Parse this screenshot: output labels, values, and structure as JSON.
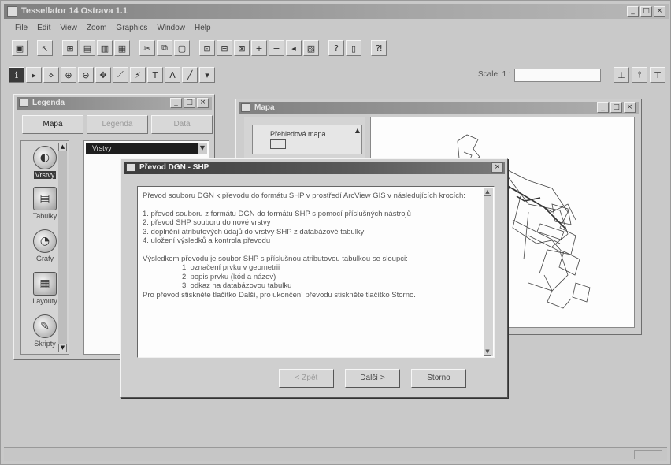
{
  "app": {
    "title": "Tessellator  14 Ostrava  1.1",
    "menu": [
      "File",
      "Edit",
      "View",
      "Zoom",
      "Graphics",
      "Window",
      "Help"
    ],
    "scale_label": "Scale: 1 :",
    "scale_value": ""
  },
  "left_panel": {
    "title": "Legenda",
    "tabs": [
      {
        "label": "Mapa",
        "state": "active"
      },
      {
        "label": "Legenda",
        "state": "disabled"
      },
      {
        "label": "Data",
        "state": "disabled"
      }
    ],
    "icons": [
      {
        "label": "Vrstvy",
        "icon": "layers-icon"
      },
      {
        "label": "Tabulky",
        "icon": "table-icon"
      },
      {
        "label": "Grafy",
        "icon": "chart-icon"
      },
      {
        "label": "Layouty",
        "icon": "layout-icon"
      },
      {
        "label": "Skripty",
        "icon": "script-icon"
      }
    ],
    "layer_dropdown": "Vrstvy"
  },
  "map_window": {
    "title": "Mapa",
    "dropdown": "Přehledová mapa"
  },
  "dialog": {
    "title": "Převod DGN - SHP",
    "intro": "Převod souboru DGN k převodu do formátu SHP v prostředí ArcView GIS v následujících krocích:",
    "steps": [
      "1. převod souboru z formátu DGN do formátu SHP s pomocí příslušných nástrojů",
      "2. převod SHP souboru do nové vrstvy",
      "3. doplnění atributových údajů do vrstvy SHP z databázové tabulky",
      "4. uložení výsledků a kontrola převodu"
    ],
    "para2": "Výsledkem převodu je soubor SHP s příslušnou atributovou tabulkou se sloupci:",
    "sub_items": [
      "1. označení prvku v geometrii",
      "2. popis prvku (kód a název)",
      "3. odkaz na databázovou tabulku"
    ],
    "para3": "Pro převod stiskněte tlačítko Další, pro ukončení převodu stiskněte tlačítko Storno.",
    "buttons": [
      {
        "label": "< Zpět",
        "state": "disabled"
      },
      {
        "label": "Další >",
        "state": "enabled"
      },
      {
        "label": "Storno",
        "state": "enabled"
      }
    ]
  }
}
